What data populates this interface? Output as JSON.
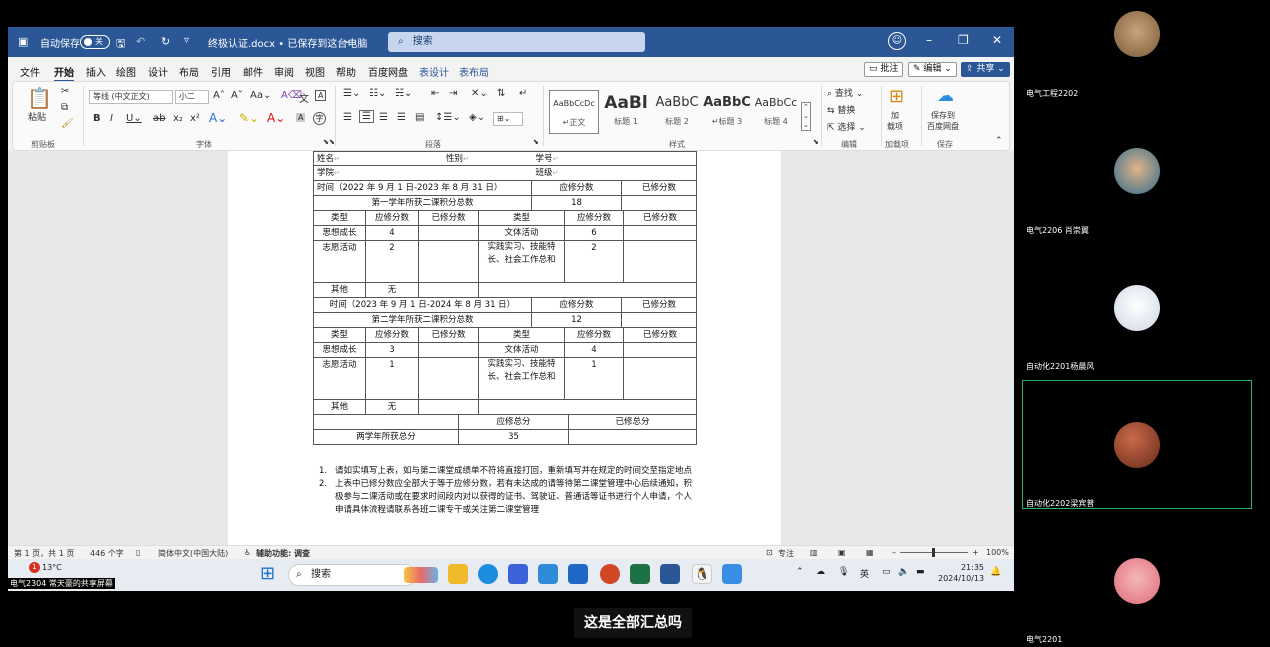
{
  "titlebar": {
    "autosave": "自动保存",
    "toggle": "关",
    "filename": "终极认证.docx • 已保存到这台电脑",
    "search": "搜索"
  },
  "menu": {
    "tabs": [
      "文件",
      "开始",
      "插入",
      "绘图",
      "设计",
      "布局",
      "引用",
      "邮件",
      "审阅",
      "视图",
      "帮助",
      "百度网盘",
      "表设计",
      "表布局"
    ],
    "active": "开始",
    "comment": "批注",
    "edit": "编辑",
    "share": "共享"
  },
  "ribbon": {
    "paste": "粘贴",
    "font_name": "等线 (中文正文)",
    "font_size": "小二",
    "styles": [
      {
        "preview": "AaBbCcDc",
        "name": "正文"
      },
      {
        "preview": "AaBl",
        "name": "标题 1"
      },
      {
        "preview": "AaBbC",
        "name": "标题 2"
      },
      {
        "preview": "AaBbC",
        "name": "标题 3"
      },
      {
        "preview": "AaBbCc",
        "name": "标题 4"
      }
    ],
    "find": "查找",
    "replace": "替换",
    "select": "选择",
    "addin": "加\n载项",
    "save_baidu": "保存到\n百度网盘",
    "groups": [
      "剪贴板",
      "字体",
      "段落",
      "样式",
      "编辑",
      "加载项",
      "保存"
    ]
  },
  "doc": {
    "r1": {
      "name": "姓名",
      "gender": "性别",
      "id": "学号"
    },
    "r2": {
      "college": "学院",
      "class": "班级"
    },
    "y1": {
      "period": "时间（2022 年 9 月 1 日-2023 年 8 月 31 日）",
      "req": "应修分数",
      "done": "已修分数",
      "total_label": "第一学年所获二课积分总数",
      "total": "18"
    },
    "hdr": {
      "type": "类型",
      "req": "应修分数",
      "done": "已修分数"
    },
    "y1rows": {
      "ideo": "思想成长",
      "ideo_req": "4",
      "arts": "文体活动",
      "arts_req": "6",
      "vol": "志愿活动",
      "vol_req": "2",
      "prac": "实践实习、技能特长、社会工作总和",
      "prac_req": "2",
      "other": "其他",
      "other_req": "无"
    },
    "y2": {
      "period": "时间（2023 年 9 月 1 日-2024 年 8 月 31 日）",
      "total_label": "第二学年所获二课积分总数",
      "total": "12"
    },
    "y2rows": {
      "ideo_req": "3",
      "arts_req": "4",
      "vol_req": "1",
      "prac_req": "1",
      "other_req": "无"
    },
    "sum": {
      "req_total": "应修总分",
      "done_total": "已修总分",
      "two_year": "两学年所获总分",
      "two_year_val": "35"
    },
    "notes": [
      "请如实填写上表，如与第二课堂成绩单不符将直接打回，重新填写并在规定的时间交至指定地点",
      "上表中已修分数应全部大于等于应修分数，若有未达成的请等待第二课堂管理中心后续通知，积极参与二课活动或在要求时间段内对以获得的证书、驾驶证、普通话等证书进行个人申请，个人申请具体流程请联系各班二课专干或关注第二课堂管理"
    ]
  },
  "status": {
    "page": "第 1 页，共 1 页",
    "words": "446 个字",
    "lang": "简体中文(中国大陆)",
    "access": "辅助功能: 调查",
    "focus": "专注",
    "zoom": "100%"
  },
  "taskbar": {
    "weather": "13°C",
    "badge": "1",
    "search": "搜索",
    "ime": "英",
    "time": "21:35",
    "date": "2024/10/13"
  },
  "presenter": "电气2304 常天豪的共享屏幕",
  "participants": [
    "电气工程2202",
    "电气2206 肖崇翼",
    "自动化2201杨晨风",
    "自动化2202梁宾普",
    "电气2201"
  ],
  "subtitle": "这是全部汇总吗"
}
